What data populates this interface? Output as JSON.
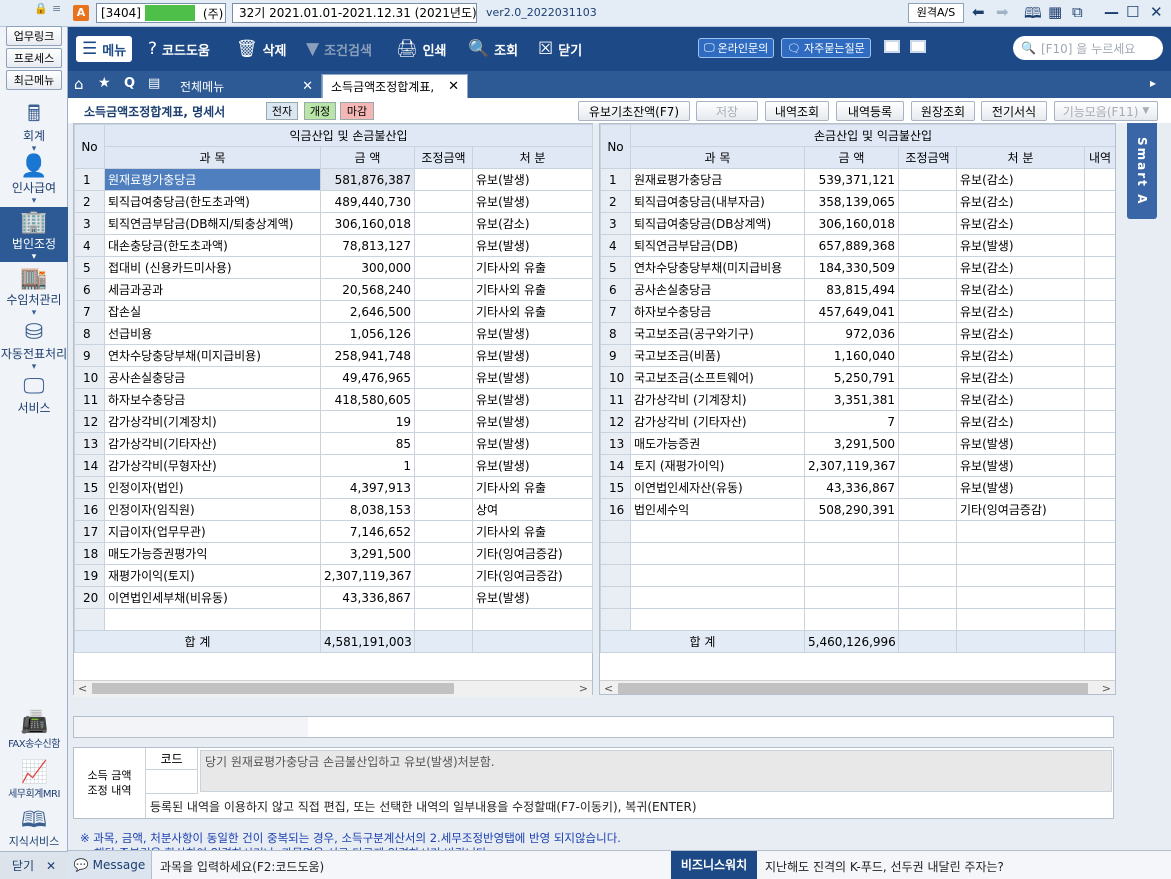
{
  "titlebar": {
    "company_code": "[3404]",
    "company_suffix": "(주)",
    "period": "32기  2021.01.01-2021.12.31  (2021년도)",
    "version": "ver2.0_2022031103",
    "remote_label": "원격A/S"
  },
  "sidebar": {
    "top_buttons": [
      "업무링크",
      "프로세스",
      "최근메뉴"
    ],
    "items": [
      {
        "label": "회계",
        "icon": "calculator-icon"
      },
      {
        "label": "인사급여",
        "icon": "person-coins-icon"
      },
      {
        "label": "법인조정",
        "icon": "building-icon"
      },
      {
        "label": "수임처관리",
        "icon": "office-people-icon"
      },
      {
        "label": "자동전표처리",
        "icon": "database-gear-icon"
      },
      {
        "label": "서비스",
        "icon": "monitor-icon"
      }
    ],
    "bottom_items": [
      {
        "label": "FAX송수신함",
        "icon": "fax-icon"
      },
      {
        "label": "세무회계MRI",
        "icon": "pulse-icon"
      },
      {
        "label": "지식서비스",
        "icon": "book-icon"
      }
    ],
    "close_label": "닫기"
  },
  "toolbar": {
    "menu": "메뉴",
    "code_help": "코드도움",
    "delete": "삭제",
    "filter": "조건검색",
    "print": "인쇄",
    "view": "조회",
    "close": "닫기",
    "online_inquiry": "온라인문의",
    "faq": "자주묻는질문",
    "search_placeholder": "[F10] 을 누르세요"
  },
  "tabs": {
    "all_menu": "전체메뉴",
    "current": "소득금액조정합계표,"
  },
  "form": {
    "title": "소득금액조정합계표, 명세서",
    "badge_elec": "전자",
    "badge_rev": "개정",
    "badge_close": "마감",
    "buttons": [
      "유보기초잔액(F7)",
      "저장",
      "내역조회",
      "내역등록",
      "원장조회",
      "전기서식",
      "기능모음(F11)"
    ]
  },
  "left_table": {
    "group_header": "익금산입 및 손금불산입",
    "col_no": "No",
    "col_subject": "과 목",
    "col_amount": "금 액",
    "col_adjust": "조정금액",
    "col_disposal": "처 분",
    "rows": [
      {
        "no": "1",
        "subject": "원재료평가충당금",
        "amount": "581,876,387",
        "disposal": "유보(발생)"
      },
      {
        "no": "2",
        "subject": "퇴직급여충당금(한도초과액)",
        "amount": "489,440,730",
        "disposal": "유보(발생)"
      },
      {
        "no": "3",
        "subject": "퇴직연금부담금(DB해지/퇴충상계액)",
        "amount": "306,160,018",
        "disposal": "유보(감소)"
      },
      {
        "no": "4",
        "subject": "대손충당금(한도초과액)",
        "amount": "78,813,127",
        "disposal": "유보(발생)"
      },
      {
        "no": "5",
        "subject": "접대비 (신용카드미사용)",
        "amount": "300,000",
        "disposal": "기타사외 유출"
      },
      {
        "no": "6",
        "subject": "세금과공과",
        "amount": "20,568,240",
        "disposal": "기타사외 유출"
      },
      {
        "no": "7",
        "subject": "잡손실",
        "amount": "2,646,500",
        "disposal": "기타사외 유출"
      },
      {
        "no": "8",
        "subject": "선급비용",
        "amount": "1,056,126",
        "disposal": "유보(발생)"
      },
      {
        "no": "9",
        "subject": "연차수당충당부채(미지급비용)",
        "amount": "258,941,748",
        "disposal": "유보(발생)"
      },
      {
        "no": "10",
        "subject": "공사손실충당금",
        "amount": "49,476,965",
        "disposal": "유보(발생)"
      },
      {
        "no": "11",
        "subject": "하자보수충당금",
        "amount": "418,580,605",
        "disposal": "유보(발생)"
      },
      {
        "no": "12",
        "subject": "감가상각비(기계장치)",
        "amount": "19",
        "disposal": "유보(발생)"
      },
      {
        "no": "13",
        "subject": "감가상각비(기타자산)",
        "amount": "85",
        "disposal": "유보(발생)"
      },
      {
        "no": "14",
        "subject": "감가상각비(무형자산)",
        "amount": "1",
        "disposal": "유보(발생)"
      },
      {
        "no": "15",
        "subject": "인정이자(법인)",
        "amount": "4,397,913",
        "disposal": "기타사외 유출"
      },
      {
        "no": "16",
        "subject": "인정이자(임직원)",
        "amount": "8,038,153",
        "disposal": "상여"
      },
      {
        "no": "17",
        "subject": "지급이자(업무무관)",
        "amount": "7,146,652",
        "disposal": "기타사외 유출"
      },
      {
        "no": "18",
        "subject": "매도가능증권평가익",
        "amount": "3,291,500",
        "disposal": "기타(잉여금증감)"
      },
      {
        "no": "19",
        "subject": "재평가이익(토지)",
        "amount": "2,307,119,367",
        "disposal": "기타(잉여금증감)"
      },
      {
        "no": "20",
        "subject": "이연법인세부채(비유동)",
        "amount": "43,336,867",
        "disposal": "유보(발생)"
      }
    ],
    "total_label": "합 계",
    "total_amount": "4,581,191,003"
  },
  "right_table": {
    "group_header": "손금산입 및 익금불산입",
    "col_no": "No",
    "col_subject": "과 목",
    "col_amount": "금 액",
    "col_adjust": "조정금액",
    "col_disposal": "처 분",
    "col_detail": "내역",
    "rows": [
      {
        "no": "1",
        "subject": "원재료평가충당금",
        "amount": "539,371,121",
        "disposal": "유보(감소)"
      },
      {
        "no": "2",
        "subject": "퇴직급여충당금(내부자금)",
        "amount": "358,139,065",
        "disposal": "유보(감소)"
      },
      {
        "no": "3",
        "subject": "퇴직급여충당금(DB상계액)",
        "amount": "306,160,018",
        "disposal": "유보(감소)"
      },
      {
        "no": "4",
        "subject": "퇴직연금부담금(DB)",
        "amount": "657,889,368",
        "disposal": "유보(발생)"
      },
      {
        "no": "5",
        "subject": "연차수당충당부채(미지급비용",
        "amount": "184,330,509",
        "disposal": "유보(감소)"
      },
      {
        "no": "6",
        "subject": "공사손실충당금",
        "amount": "83,815,494",
        "disposal": "유보(감소)"
      },
      {
        "no": "7",
        "subject": "하자보수충당금",
        "amount": "457,649,041",
        "disposal": "유보(감소)"
      },
      {
        "no": "8",
        "subject": "국고보조금(공구와기구)",
        "amount": "972,036",
        "disposal": "유보(감소)"
      },
      {
        "no": "9",
        "subject": "국고보조금(비품)",
        "amount": "1,160,040",
        "disposal": "유보(감소)"
      },
      {
        "no": "10",
        "subject": "국고보조금(소프트웨어)",
        "amount": "5,250,791",
        "disposal": "유보(감소)"
      },
      {
        "no": "11",
        "subject": "감가상각비 (기계장치)",
        "amount": "3,351,381",
        "disposal": "유보(감소)"
      },
      {
        "no": "12",
        "subject": "감가상각비 (기타자산)",
        "amount": "7",
        "disposal": "유보(감소)"
      },
      {
        "no": "13",
        "subject": "매도가능증권",
        "amount": "3,291,500",
        "disposal": "유보(발생)"
      },
      {
        "no": "14",
        "subject": "토지 (재평가이익)",
        "amount": "2,307,119,367",
        "disposal": "유보(발생)"
      },
      {
        "no": "15",
        "subject": "이연법인세자산(유동)",
        "amount": "43,336,867",
        "disposal": "유보(발생)"
      },
      {
        "no": "16",
        "subject": "법인세수익",
        "amount": "508,290,391",
        "disposal": "기타(잉여금증감)"
      }
    ],
    "total_label": "합 계",
    "total_amount": "5,460,126,996"
  },
  "detail": {
    "section_label": "소득 금액\n조정 내역",
    "code_label": "코드",
    "text": "당기 원재료평가충당금 손금불산입하고 유보(발생)처분함.",
    "hint": "등록된 내역을 이용하지 않고 직접 편집, 또는 선택한 내역의 일부내용을 수정할때(F7-이동키), 복귀(ENTER)"
  },
  "notice": {
    "line1": "※ 과목, 금액, 처분사항이 동일한 건이 중복되는 경우, 소득구분계산서의 2.세무조정반영탭에 반영 되지않습니다.",
    "line2": "해당 중복건을 합산하여 입력하시거나, 과목명을 서로 다르게 입력하시기 바랍니다."
  },
  "statusbar": {
    "message_label": "Message",
    "prompt": "과목을 입력하세요(F2:코드도움)",
    "news_label": "비즈니스워치",
    "news_text": "지난해도 진격의 K-푸드, 선두권 내달린 주자는?"
  },
  "smart_a": "Smart A",
  "colors": {
    "toolbar_bg": "#1d4a86",
    "selected_cell": "#4f7fbe",
    "header_cell": "#dfe8f4",
    "badge_rev": "#b9e6a8",
    "badge_close": "#f5b6b6",
    "company_green": "#4ec04a"
  }
}
